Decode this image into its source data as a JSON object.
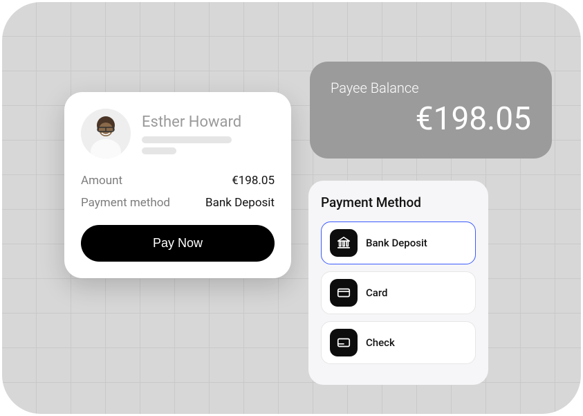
{
  "payee": {
    "name": "Esther Howard",
    "amount_label": "Amount",
    "amount_value": "€198.05",
    "method_label": "Payment method",
    "method_value": "Bank Deposit",
    "pay_button": "Pay Now"
  },
  "balance": {
    "label": "Payee Balance",
    "value": "€198.05"
  },
  "methods": {
    "title": "Payment Method",
    "options": [
      {
        "label": "Bank Deposit",
        "icon": "bank",
        "selected": true
      },
      {
        "label": "Card",
        "icon": "card",
        "selected": false
      },
      {
        "label": "Check",
        "icon": "check",
        "selected": false
      }
    ]
  }
}
